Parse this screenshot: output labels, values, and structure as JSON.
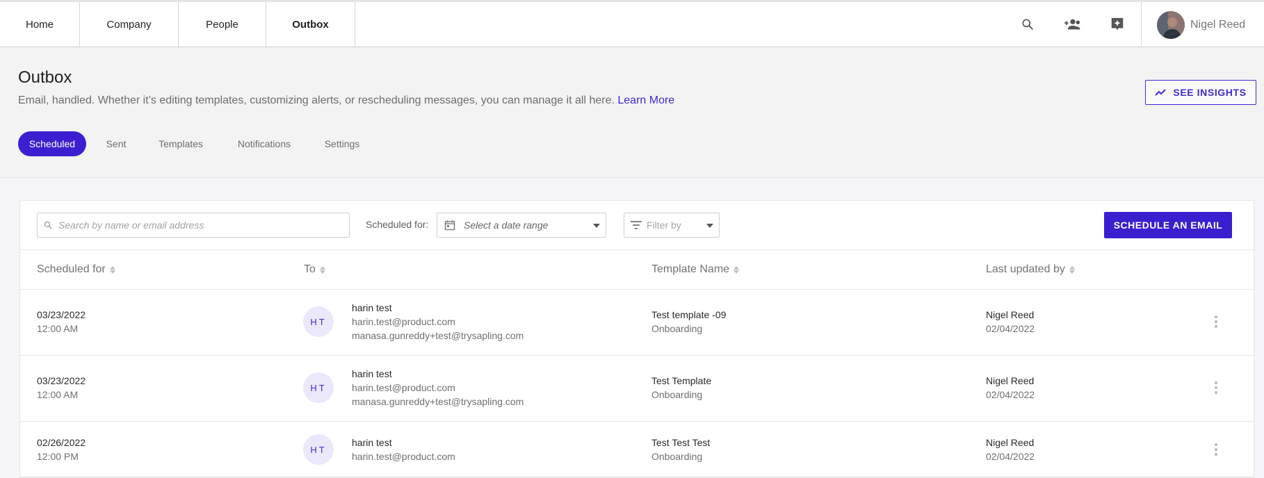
{
  "nav": {
    "tabs": [
      {
        "label": "Home"
      },
      {
        "label": "Company"
      },
      {
        "label": "People"
      },
      {
        "label": "Outbox",
        "active": true
      }
    ],
    "icons": [
      "search-icon",
      "add-people-icon",
      "sparkle-bubble-icon"
    ],
    "user_name": "Nigel Reed"
  },
  "header": {
    "title": "Outbox",
    "subtitle": "Email, handled. Whether it’s editing templates, customizing alerts, or rescheduling messages, you can manage it all here.",
    "learn_more": "Learn More",
    "insights_label": "SEE INSIGHTS"
  },
  "subtabs": [
    "Scheduled",
    "Sent",
    "Templates",
    "Notifications",
    "Settings"
  ],
  "toolbar": {
    "search_placeholder": "Search by name or email address",
    "scheduled_for_label": "Scheduled for:",
    "date_range_placeholder": "Select a date range",
    "filter_placeholder": "Filter by",
    "schedule_button": "SCHEDULE AN EMAIL"
  },
  "table": {
    "columns": [
      "Scheduled for",
      "To",
      "Template Name",
      "Last updated by"
    ],
    "rows": [
      {
        "date": "03/23/2022",
        "time": "12:00 AM",
        "initials": "HT",
        "to_name": "harin test",
        "to_email": "harin.test@product.com",
        "to_cc": "manasa.gunreddy+test@trysapling.com",
        "template": "Test template -09",
        "category": "Onboarding",
        "updated_by": "Nigel Reed",
        "updated_date": "02/04/2022"
      },
      {
        "date": "03/23/2022",
        "time": "12:00 AM",
        "initials": "HT",
        "to_name": "harin test",
        "to_email": "harin.test@product.com",
        "to_cc": "manasa.gunreddy+test@trysapling.com",
        "template": "Test Template",
        "category": "Onboarding",
        "updated_by": "Nigel Reed",
        "updated_date": "02/04/2022"
      },
      {
        "date": "02/26/2022",
        "time": "12:00 PM",
        "initials": "HT",
        "to_name": "harin test",
        "to_email": "harin.test@product.com",
        "template": "Test Test Test",
        "category": "Onboarding",
        "updated_by": "Nigel Reed",
        "updated_date": "02/04/2022"
      }
    ]
  },
  "colors": {
    "accent": "#3d1fd1",
    "accent_light": "#ebe8fb",
    "page_bg": "#f3f3f3"
  }
}
